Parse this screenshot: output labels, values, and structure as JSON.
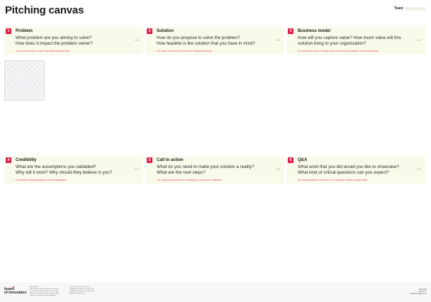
{
  "header": {
    "title": "Pitching canvas",
    "team_label": "Team"
  },
  "cards": [
    {
      "num": "1",
      "title": "Problem",
      "q1": "What problem are you aiming to solve?",
      "q2": "How does it impact the problem owner?",
      "tip": "Tip: explain from a human centred perspective."
    },
    {
      "num": "2",
      "title": "Solution",
      "q1": "How do you propose to solve the problem?",
      "q2": "How feasible is the solution that you have in mind?",
      "tip": "Tip: show a prototype or visual representation."
    },
    {
      "num": "3",
      "title": "Business model",
      "q1": "How will you capture value? How much value will this",
      "q2": "solution bring to your organisation?",
      "tip": "Tip: show ball park figures and focus on the underlying assumptions."
    },
    {
      "num": "4",
      "title": "Credibility",
      "q1": "What are the assumptions you validated?",
      "q2": "Why will it work? Why should they believe in you?",
      "tip": "Tip: show concrete results of experiments."
    },
    {
      "num": "5",
      "title": "Call to action",
      "q1": "What do you need to make your solution a reality?",
      "q2": "What are the next steps?",
      "tip": "Tip: guide the decision by offering a clear way forward."
    },
    {
      "num": "6",
      "title": "Q&A",
      "q1": "What work that you did would you like to showcase?",
      "q2": "What kind of critical questions can you expect?",
      "tip": "Tip: leave bread in your pitch to trigger specific questions."
    }
  ],
  "footer": {
    "logo_line1": "board",
    "logo_line2": "of innovation",
    "col1": "About Board\nThe Pitching canvas helps you to structure\nyour pitch in order to convince and inspire\ndecision makers to invest in your idea and\nmake the next step towards validation.",
    "col2": "You can use this tool as it is or\ncustomize it to your own needs. For\nfeedback or questions, contact us at\nboardofinnovation.com",
    "right": "CREATED\nlicense: cc\nboardofinnovation.com"
  }
}
